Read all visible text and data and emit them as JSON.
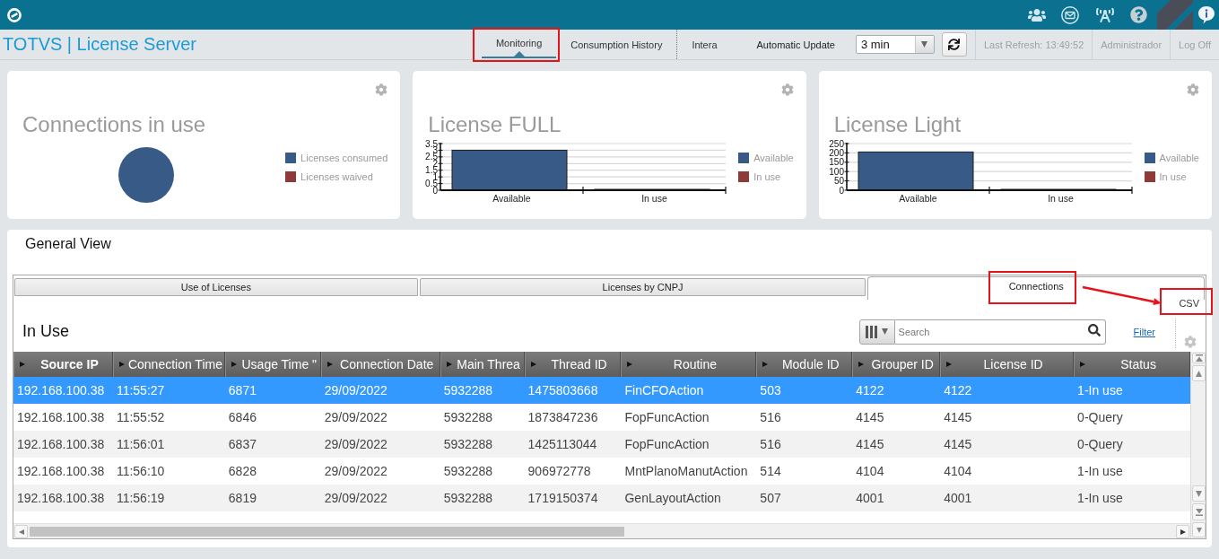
{
  "header": {
    "title": "TOTVS | License Server",
    "nav": [
      {
        "label": "Monitoring",
        "selected": true,
        "highlighted": true
      },
      {
        "label": "Consumption History",
        "selected": false,
        "highlighted": false
      },
      {
        "label": "Intera",
        "selected": false,
        "highlighted": false
      }
    ],
    "auto_update": {
      "label": "Automatic Update",
      "value": "3 min"
    },
    "last_refresh": "Last Refresh: 13:49:52",
    "user": "Administrador",
    "log_off": "Log Off"
  },
  "cards": [
    {
      "kind": "pie",
      "title": "Connections in use",
      "legend": [
        {
          "label": "Licenses consumed",
          "color": "#375a86"
        },
        {
          "label": "Licenses waived",
          "color": "#8e3a38"
        }
      ]
    },
    {
      "kind": "bar",
      "chart_data": {
        "type": "bar",
        "title": "License FULL",
        "categories": [
          "Available",
          "In use"
        ],
        "values": [
          3,
          0
        ],
        "ylim": [
          0,
          3.5
        ],
        "yticks": [
          0,
          0.5,
          1,
          1.5,
          2,
          2.5,
          3,
          3.5
        ],
        "grid": true
      },
      "legend": [
        {
          "label": "Available",
          "color": "#375a86"
        },
        {
          "label": "In use",
          "color": "#8e3a38"
        }
      ]
    },
    {
      "kind": "bar",
      "chart_data": {
        "type": "bar",
        "title": "License Light",
        "categories": [
          "Available",
          "In use"
        ],
        "values": [
          205,
          2
        ],
        "ylim": [
          0,
          250
        ],
        "yticks": [
          0,
          50,
          100,
          150,
          200,
          250
        ],
        "grid": true
      },
      "legend": [
        {
          "label": "Available",
          "color": "#375a86"
        },
        {
          "label": "In use",
          "color": "#8e3a38"
        }
      ]
    }
  ],
  "general_view": {
    "title": "General View",
    "tabs": [
      {
        "label": "Use of Licenses",
        "selected": false,
        "highlighted": false
      },
      {
        "label": "Licenses by CNPJ",
        "selected": false,
        "highlighted": false
      },
      {
        "label": "Connections",
        "selected": true,
        "highlighted": true
      }
    ],
    "annotation_arrow": true,
    "csv": {
      "label": "CSV",
      "highlighted": true
    },
    "section_title": "In Use",
    "search": {
      "placeholder": "Search"
    },
    "filter": "Filter",
    "table": {
      "columns": [
        {
          "label": "Source IP",
          "sorted": true
        },
        {
          "label": "Connection Time",
          "sorted": false
        },
        {
          "label": "Usage Time \"",
          "sorted": false
        },
        {
          "label": "Connection Date",
          "sorted": false
        },
        {
          "label": "Main Threa",
          "sorted": false
        },
        {
          "label": "Thread ID",
          "sorted": false
        },
        {
          "label": "Routine",
          "sorted": false
        },
        {
          "label": "Module ID",
          "sorted": false
        },
        {
          "label": "Grouper ID",
          "sorted": false
        },
        {
          "label": "License ID",
          "sorted": false
        },
        {
          "label": "Status",
          "sorted": false
        }
      ],
      "rows": [
        {
          "selected": true,
          "cells": [
            "192.168.100.38",
            "11:55:27",
            "6871",
            "29/09/2022",
            "5932288",
            "1475803668",
            "FinCFOAction",
            "503",
            "4122",
            "4122",
            "1-In use"
          ]
        },
        {
          "selected": false,
          "cells": [
            "192.168.100.38",
            "11:55:52",
            "6846",
            "29/09/2022",
            "5932288",
            "1873847236",
            "FopFuncAction",
            "516",
            "4145",
            "4145",
            "0-Query"
          ]
        },
        {
          "selected": false,
          "cells": [
            "192.168.100.38",
            "11:56:01",
            "6837",
            "29/09/2022",
            "5932288",
            "1425113044",
            "FopFuncAction",
            "516",
            "4145",
            "4145",
            "0-Query"
          ]
        },
        {
          "selected": false,
          "cells": [
            "192.168.100.38",
            "11:56:10",
            "6828",
            "29/09/2022",
            "5932288",
            "906972778",
            "MntPlanoManutAction",
            "514",
            "4104",
            "4104",
            "1-In use"
          ]
        },
        {
          "selected": false,
          "cells": [
            "192.168.100.38",
            "11:56:19",
            "6819",
            "29/09/2022",
            "5932288",
            "1719150374",
            "GenLayoutAction",
            "507",
            "4001",
            "4001",
            "1-In use"
          ]
        }
      ]
    }
  }
}
